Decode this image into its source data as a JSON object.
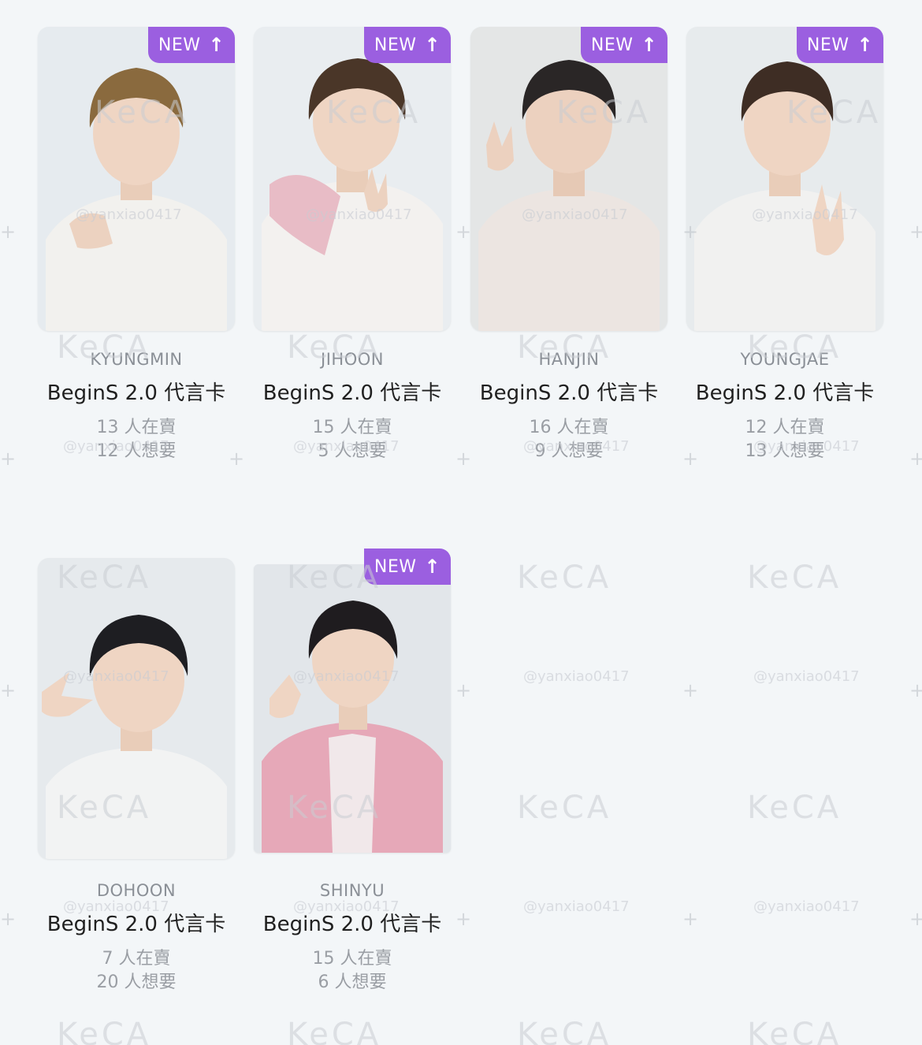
{
  "cards": [
    {
      "member": "KYUNGMIN",
      "title": "BeginS 2.0 代言卡",
      "selling": "13 人在賣",
      "wanting": "12 人想要",
      "is_new": true,
      "new_label": "NEW",
      "shirt_color": "#f2f1ee",
      "accent_color": "#f2f1ee",
      "hair_color": "#8a6a3e",
      "bg_color": "#e6ebef"
    },
    {
      "member": "JIHOON",
      "title": "BeginS 2.0 代言卡",
      "selling": "15 人在賣",
      "wanting": "5 人想要",
      "is_new": true,
      "new_label": "NEW",
      "shirt_color": "#f3f1ef",
      "accent_color": "#e8bcc6",
      "hair_color": "#4a3628",
      "bg_color": "#e9edf0"
    },
    {
      "member": "HANJIN",
      "title": "BeginS 2.0 代言卡",
      "selling": "16 人在賣",
      "wanting": "9 人想要",
      "is_new": true,
      "new_label": "NEW",
      "shirt_color": "#ece5e1",
      "accent_color": "#ece5e1",
      "hair_color": "#2a2626",
      "bg_color": "#e4e6e6"
    },
    {
      "member": "YOUNGJAE",
      "title": "BeginS 2.0 代言卡",
      "selling": "12 人在賣",
      "wanting": "13 人想要",
      "is_new": true,
      "new_label": "NEW",
      "shirt_color": "#f1f1f0",
      "accent_color": "#f1f1f0",
      "hair_color": "#3e2d24",
      "bg_color": "#e7ebed"
    },
    {
      "member": "DOHOON",
      "title": "BeginS 2.0 代言卡",
      "selling": "7 人在賣",
      "wanting": "20 人想要",
      "is_new": false,
      "new_label": "",
      "shirt_color": "#f2f3f3",
      "accent_color": "#f2f3f3",
      "hair_color": "#1e1e22",
      "bg_color": "#e6eaed"
    },
    {
      "member": "SHINYU",
      "title": "BeginS 2.0 代言卡",
      "selling": "15 人在賣",
      "wanting": "6 人想要",
      "is_new": true,
      "new_label": "NEW",
      "shirt_color": "#e6a8b8",
      "accent_color": "#f1e8ea",
      "hair_color": "#1f1c1f",
      "bg_color": "#e2e6ea"
    }
  ],
  "watermarks": {
    "logo": "KeCA",
    "handle": "@yanxiao0417"
  },
  "colors": {
    "new_badge": "#9b5fe0",
    "page_bg": "#f3f6f8",
    "title_text": "#202020",
    "muted_text": "#9a9ea4"
  }
}
